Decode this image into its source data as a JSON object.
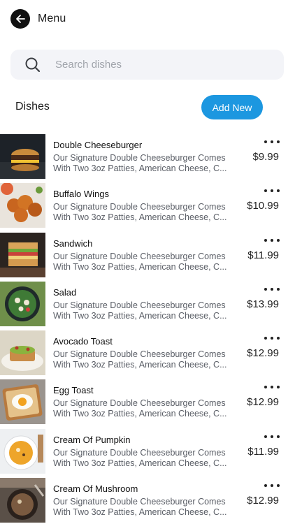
{
  "header": {
    "title": "Menu",
    "back_icon": "arrow-left-icon"
  },
  "search": {
    "placeholder": "Search dishes",
    "icon": "search-icon"
  },
  "section": {
    "title": "Dishes",
    "add_label": "Add New"
  },
  "colors": {
    "accent": "#1c97e0",
    "search_bg": "#f3f4f8",
    "text": "#1c1c1c",
    "muted": "#5a5e66"
  },
  "dishes": [
    {
      "name": "Double Cheeseburger",
      "desc1": "Our Signature Double Cheeseburger Comes",
      "desc2": "With Two 3oz Patties, American Cheese, C...",
      "price": "$9.99"
    },
    {
      "name": "Buffalo Wings",
      "desc1": "Our Signature Double Cheeseburger Comes",
      "desc2": "With Two 3oz Patties, American Cheese, C...",
      "price": "$10.99"
    },
    {
      "name": "Sandwich",
      "desc1": "Our Signature Double Cheeseburger Comes",
      "desc2": "With Two 3oz Patties, American Cheese, C...",
      "price": "$11.99"
    },
    {
      "name": "Salad",
      "desc1": "Our Signature Double Cheeseburger Comes",
      "desc2": "With Two 3oz Patties, American Cheese, C...",
      "price": "$13.99"
    },
    {
      "name": "Avocado Toast",
      "desc1": "Our Signature Double Cheeseburger Comes",
      "desc2": "With Two 3oz Patties, American Cheese, C...",
      "price": "$12.99"
    },
    {
      "name": "Egg Toast",
      "desc1": "Our Signature Double Cheeseburger Comes",
      "desc2": "With Two 3oz Patties, American Cheese, C...",
      "price": "$12.99"
    },
    {
      "name": "Cream Of Pumpkin",
      "desc1": "Our Signature Double Cheeseburger Comes",
      "desc2": "With Two 3oz Patties, American Cheese, C...",
      "price": "$11.99"
    },
    {
      "name": "Cream Of Mushroom",
      "desc1": "Our Signature Double Cheeseburger Comes",
      "desc2": "With Two 3oz Patties, American Cheese, C...",
      "price": "$12.99"
    }
  ]
}
